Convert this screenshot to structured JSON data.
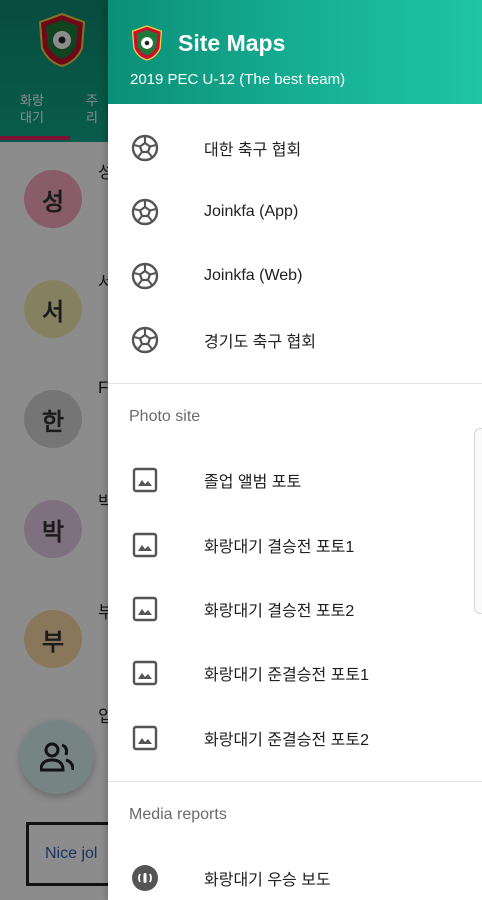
{
  "background": {
    "tabs": [
      {
        "label": "화랑\n대기"
      },
      {
        "label": "주\n리"
      }
    ],
    "rows": [
      {
        "avatar": "성",
        "name": "성",
        "color": "#f7a8c0"
      },
      {
        "avatar": "서",
        "name": "서",
        "color": "#f3ecb0"
      },
      {
        "avatar": "한",
        "name": "F",
        "color": "#d6d6d6"
      },
      {
        "avatar": "박",
        "name": "박",
        "color": "#e6cde8"
      },
      {
        "avatar": "부",
        "name": "부",
        "color": "#f7d9a6"
      }
    ],
    "last_name": "입",
    "input_text": "Nice jol"
  },
  "drawer": {
    "title": "Site Maps",
    "subtitle": "2019 PEC U-12 (The best team)",
    "links": [
      {
        "label": "대한 축구 협회",
        "icon": "soccer-ball-icon"
      },
      {
        "label": "Joinkfa (App)",
        "icon": "soccer-ball-icon"
      },
      {
        "label": "Joinkfa (Web)",
        "icon": "soccer-ball-icon"
      },
      {
        "label": "경기도 축구 협회",
        "icon": "soccer-ball-icon"
      }
    ],
    "photo_section": {
      "title": "Photo site",
      "items": [
        {
          "label": "졸업 앨범 포토",
          "icon": "image-icon"
        },
        {
          "label": "화랑대기 결승전 포토1",
          "icon": "image-icon"
        },
        {
          "label": "화랑대기 결승전 포토2",
          "icon": "image-icon"
        },
        {
          "label": "화랑대기 준결승전 포토1",
          "icon": "image-icon"
        },
        {
          "label": "화랑대기 준결승전 포토2",
          "icon": "image-icon"
        }
      ]
    },
    "media_section": {
      "title": "Media reports",
      "items": [
        {
          "label": "화랑대기 우승 보도",
          "icon": "podcast-icon"
        }
      ]
    }
  },
  "colors": {
    "header_green": "#11a88a",
    "accent_pink": "#e0245e"
  }
}
